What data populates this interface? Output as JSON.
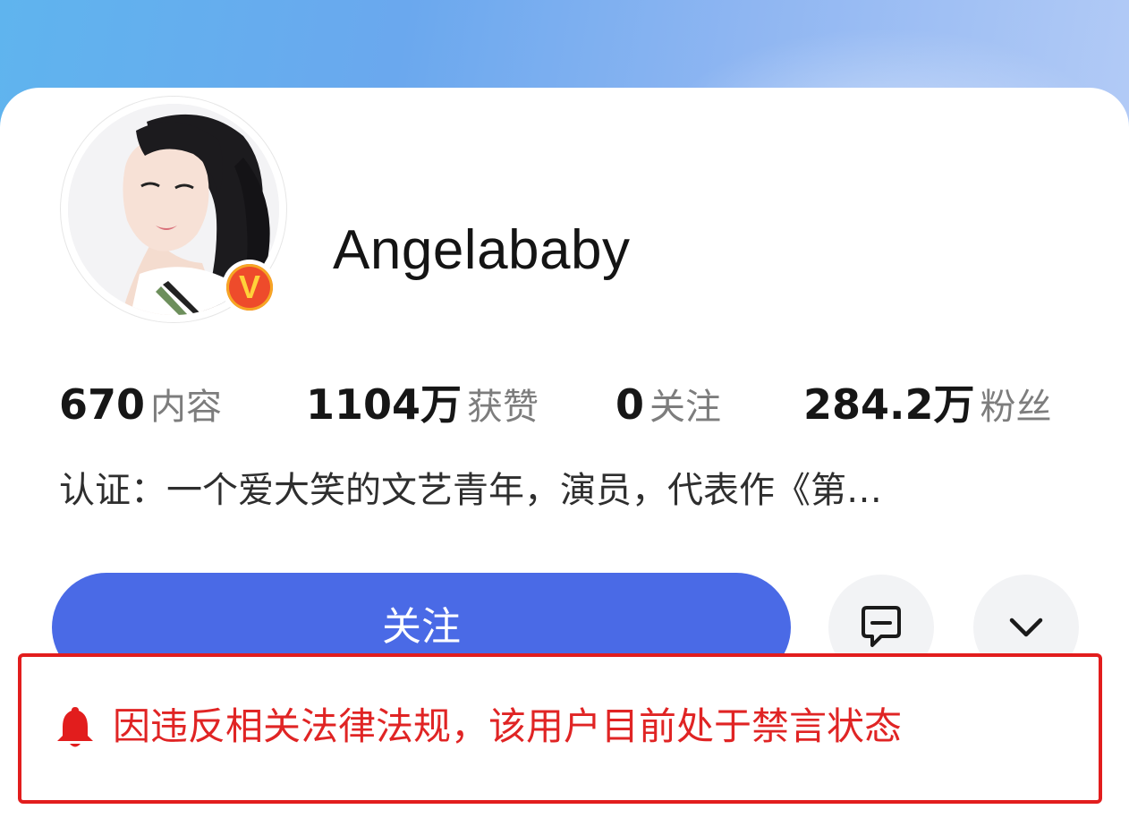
{
  "profile": {
    "name": "Angelababy",
    "verified_badge": "V",
    "bio": "认证：一个爱大笑的文艺青年，演员，代表作《第…"
  },
  "stats": [
    {
      "value": "670",
      "label": "内容"
    },
    {
      "value": "1104万",
      "label": "获赞"
    },
    {
      "value": "0",
      "label": "关注"
    },
    {
      "value": "284.2万",
      "label": "粉丝"
    }
  ],
  "actions": {
    "follow_label": "关注",
    "message_icon": "message-icon",
    "more_icon": "chevron-down-icon"
  },
  "notice": {
    "icon": "bell-icon",
    "text": "因违反相关法律法规，该用户目前处于禁言状态"
  },
  "colors": {
    "follow_button": "#4a6ae6",
    "notice_red": "#e21d1d",
    "badge_orange": "#ee4b2b",
    "badge_v": "#ffd23a"
  }
}
